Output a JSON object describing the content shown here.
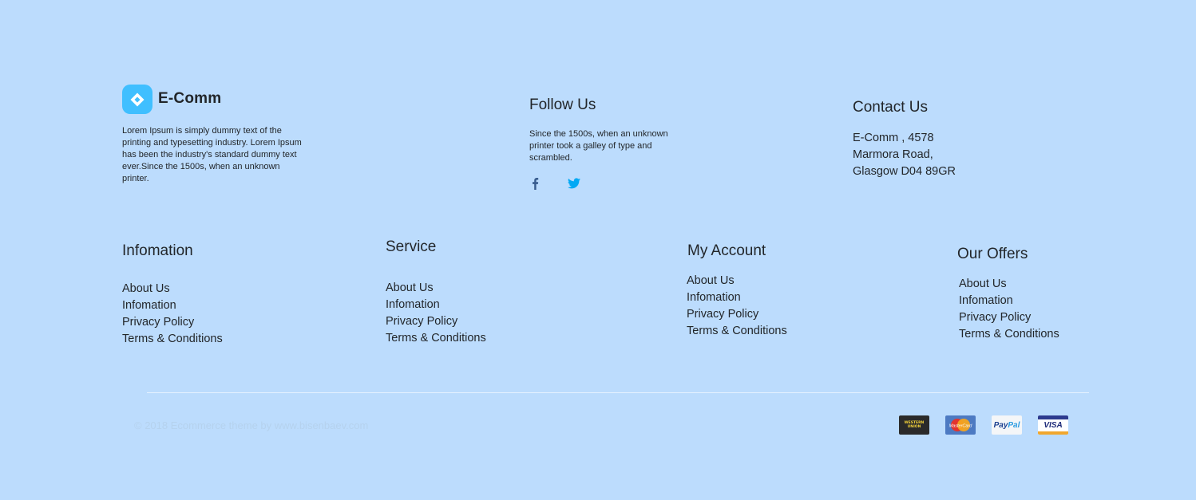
{
  "brand": {
    "name": "E-Comm",
    "description": "Lorem Ipsum is simply dummy text of the printing and typesetting industry. Lorem Ipsum has been the industry's standard dummy text ever.Since the 1500s, when an unknown printer.",
    "logo_color": "#40BFFF"
  },
  "follow": {
    "title": "Follow Us",
    "description": "Since the 1500s, when an unknown printer took a galley of type and scrambled.",
    "icons": [
      "facebook-icon",
      "twitter-icon"
    ]
  },
  "contact": {
    "title": "Contact Us",
    "lines": [
      "E-Comm , 4578",
      "Marmora Road,",
      "Glasgow D04 89GR"
    ]
  },
  "columns": [
    {
      "title": "Infomation",
      "links": [
        "About Us",
        "Infomation",
        "Privacy Policy",
        "Terms & Conditions"
      ]
    },
    {
      "title": "Service",
      "links": [
        "About Us",
        "Infomation",
        "Privacy Policy",
        "Terms & Conditions"
      ]
    },
    {
      "title": "My Account",
      "links": [
        "About Us",
        "Infomation",
        "Privacy Policy",
        "Terms & Conditions"
      ]
    },
    {
      "title": "Our Offers",
      "links": [
        "About Us",
        "Infomation",
        "Privacy Policy",
        "Terms & Conditions"
      ]
    }
  ],
  "footer": {
    "copyright": "© 2018 Ecommerce theme by www.bisenbaev.com",
    "payments": [
      {
        "name": "western-union-icon",
        "label_line1": "WESTERN",
        "label_line2": "UNION"
      },
      {
        "name": "mastercard-icon",
        "label": "MasterCard"
      },
      {
        "name": "paypal-icon",
        "label_pay": "Pay",
        "label_pal": "Pal"
      },
      {
        "name": "visa-icon",
        "label": "VISA"
      }
    ]
  },
  "colors": {
    "background": "#BCDCFD",
    "text": "#22262A",
    "accent": "#40BFFF",
    "facebook": "#385C8E",
    "twitter": "#03A9F4"
  }
}
